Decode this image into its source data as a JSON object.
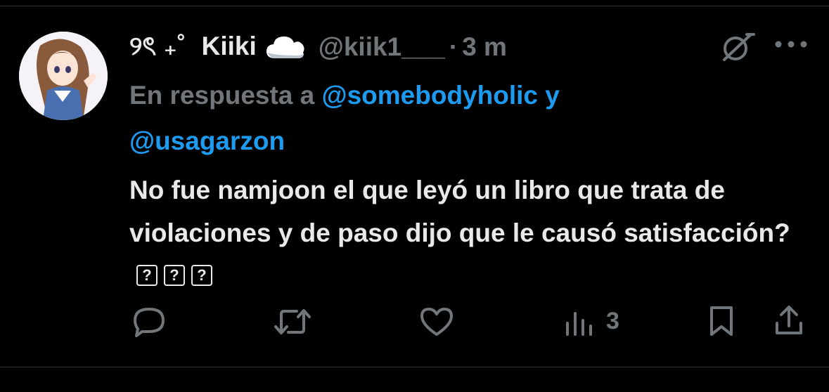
{
  "tweet": {
    "display_name_prefix": "୨ৎ ₊˚",
    "display_name": "Kiiki",
    "display_name_emoji": "cloud-icon",
    "handle": "@kiik1___",
    "separator": "·",
    "time": "3 m",
    "reply_prefix": "En respuesta a ",
    "reply_mention_1": "@somebodyholic",
    "reply_conjunction": " y",
    "reply_mention_2": "@usagarzon",
    "text": "No fue namjoon el que leyó un libro que trata de violaciones y de paso dijo que le causó satisfacción?",
    "text_trailing_glyphs": [
      "?",
      "?",
      "?"
    ]
  },
  "actions": {
    "reply_icon": "reply-icon",
    "repost_icon": "repost-icon",
    "like_icon": "heart-icon",
    "views_icon": "views-icon",
    "views_count": "3",
    "bookmark_icon": "bookmark-icon",
    "share_icon": "share-icon"
  },
  "colors": {
    "background": "#000000",
    "text_primary": "#e7e9ea",
    "text_secondary": "#71767b",
    "accent": "#1d9bf0",
    "divider": "#2f3336"
  }
}
